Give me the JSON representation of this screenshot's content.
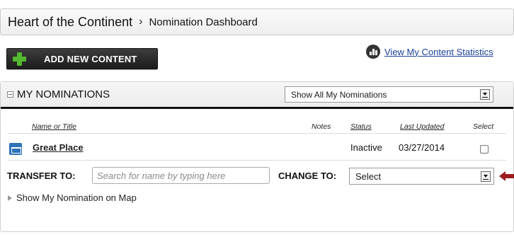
{
  "breadcrumb": {
    "root": "Heart of the Continent",
    "separator": "›",
    "current": "Nomination Dashboard"
  },
  "toolbar": {
    "add_label": "ADD NEW CONTENT",
    "stats_link": "View My Content Statistics"
  },
  "panel": {
    "title": "MY NOMINATIONS",
    "filter_value": "Show All My Nominations",
    "columns": {
      "name": "Name or Title",
      "notes": "Notes",
      "status": "Status",
      "updated": "Last Updated",
      "select": "Select"
    },
    "rows": [
      {
        "title": "Great Place",
        "notes": "",
        "status": "Inactive",
        "updated": "03/27/2014",
        "selected": false
      }
    ],
    "transfer": {
      "label": "TRANSFER TO:",
      "placeholder": "Search for name by typing here",
      "value": ""
    },
    "change": {
      "label": "CHANGE TO:",
      "value": "Select"
    },
    "map_toggle": "Show My Nomination on Map"
  },
  "colors": {
    "accent_link": "#1a3f9a",
    "plus_green": "#55b82e",
    "indicator_arrow": "#9b1c1c",
    "row_icon": "#2e72b8"
  }
}
